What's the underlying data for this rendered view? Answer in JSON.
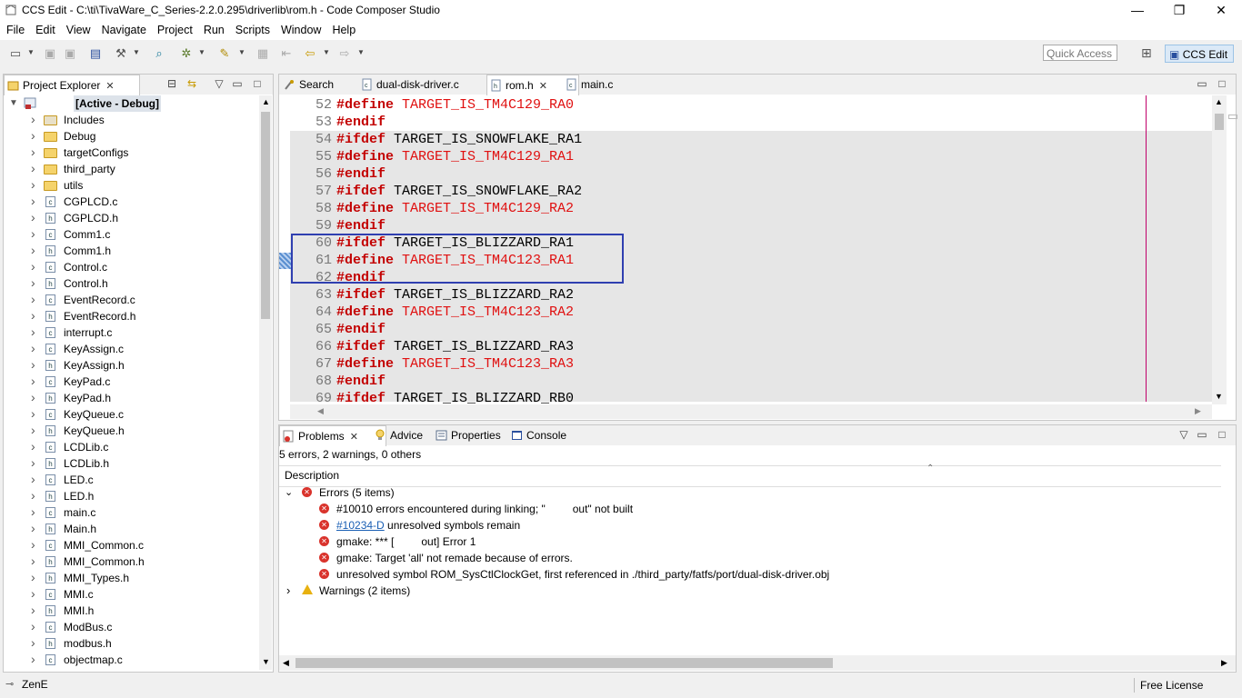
{
  "window": {
    "title": "CCS Edit - C:\\ti\\TivaWare_C_Series-2.2.0.295\\driverlib\\rom.h - Code Composer Studio",
    "minimize": "—",
    "restore": "❐",
    "close": "✕"
  },
  "menu": [
    "File",
    "Edit",
    "View",
    "Navigate",
    "Project",
    "Run",
    "Scripts",
    "Window",
    "Help"
  ],
  "toolbar": {
    "quick_access_placeholder": "Quick Access",
    "perspective_label": "CCS Edit"
  },
  "project_explorer": {
    "title": "Project Explorer",
    "root_label": "[Active - Debug]",
    "items": [
      {
        "label": "Includes",
        "kind": "includes"
      },
      {
        "label": "Debug",
        "kind": "folder"
      },
      {
        "label": "targetConfigs",
        "kind": "folder"
      },
      {
        "label": "third_party",
        "kind": "folder"
      },
      {
        "label": "utils",
        "kind": "folder"
      },
      {
        "label": "CGPLCD.c",
        "kind": "c"
      },
      {
        "label": "CGPLCD.h",
        "kind": "h"
      },
      {
        "label": "Comm1.c",
        "kind": "c"
      },
      {
        "label": "Comm1.h",
        "kind": "h"
      },
      {
        "label": "Control.c",
        "kind": "c"
      },
      {
        "label": "Control.h",
        "kind": "h"
      },
      {
        "label": "EventRecord.c",
        "kind": "c"
      },
      {
        "label": "EventRecord.h",
        "kind": "h"
      },
      {
        "label": "interrupt.c",
        "kind": "c"
      },
      {
        "label": "KeyAssign.c",
        "kind": "c"
      },
      {
        "label": "KeyAssign.h",
        "kind": "h"
      },
      {
        "label": "KeyPad.c",
        "kind": "c"
      },
      {
        "label": "KeyPad.h",
        "kind": "h"
      },
      {
        "label": "KeyQueue.c",
        "kind": "c"
      },
      {
        "label": "KeyQueue.h",
        "kind": "h"
      },
      {
        "label": "LCDLib.c",
        "kind": "c"
      },
      {
        "label": "LCDLib.h",
        "kind": "h"
      },
      {
        "label": "LED.c",
        "kind": "c"
      },
      {
        "label": "LED.h",
        "kind": "h"
      },
      {
        "label": "main.c",
        "kind": "c"
      },
      {
        "label": "Main.h",
        "kind": "h"
      },
      {
        "label": "MMI_Common.c",
        "kind": "c"
      },
      {
        "label": "MMI_Common.h",
        "kind": "h"
      },
      {
        "label": "MMI_Types.h",
        "kind": "h"
      },
      {
        "label": "MMI.c",
        "kind": "c"
      },
      {
        "label": "MMI.h",
        "kind": "h"
      },
      {
        "label": "ModBus.c",
        "kind": "c"
      },
      {
        "label": "modbus.h",
        "kind": "h"
      },
      {
        "label": "objectmap.c",
        "kind": "c"
      }
    ]
  },
  "editor": {
    "tabs": [
      {
        "label": "Search",
        "active": false
      },
      {
        "label": "dual-disk-driver.c",
        "active": false
      },
      {
        "label": "rom.h",
        "active": true
      },
      {
        "label": "main.c",
        "active": false
      }
    ],
    "lines": [
      {
        "num": "52",
        "directive": "#define",
        "name": "TARGET_IS_TM4C129_RA0"
      },
      {
        "num": "53",
        "directive": "#endif",
        "name": ""
      },
      {
        "num": "54",
        "directive": "#ifdef",
        "name": "TARGET_IS_SNOWFLAKE_RA1"
      },
      {
        "num": "55",
        "directive": "#define",
        "name": "TARGET_IS_TM4C129_RA1"
      },
      {
        "num": "56",
        "directive": "#endif",
        "name": ""
      },
      {
        "num": "57",
        "directive": "#ifdef",
        "name": "TARGET_IS_SNOWFLAKE_RA2"
      },
      {
        "num": "58",
        "directive": "#define",
        "name": "TARGET_IS_TM4C129_RA2"
      },
      {
        "num": "59",
        "directive": "#endif",
        "name": ""
      },
      {
        "num": "60",
        "directive": "#ifdef",
        "name": "TARGET_IS_BLIZZARD_RA1"
      },
      {
        "num": "61",
        "directive": "#define",
        "name": "TARGET_IS_TM4C123_RA1"
      },
      {
        "num": "62",
        "directive": "#endif",
        "name": ""
      },
      {
        "num": "63",
        "directive": "#ifdef",
        "name": "TARGET_IS_BLIZZARD_RA2"
      },
      {
        "num": "64",
        "directive": "#define",
        "name": "TARGET_IS_TM4C123_RA2"
      },
      {
        "num": "65",
        "directive": "#endif",
        "name": ""
      },
      {
        "num": "66",
        "directive": "#ifdef",
        "name": "TARGET_IS_BLIZZARD_RA3"
      },
      {
        "num": "67",
        "directive": "#define",
        "name": "TARGET_IS_TM4C123_RA3"
      },
      {
        "num": "68",
        "directive": "#endif",
        "name": ""
      },
      {
        "num": "69",
        "directive": "#ifdef",
        "name": "TARGET_IS_BLIZZARD_RB0"
      }
    ]
  },
  "problems": {
    "tabs": [
      "Problems",
      "Advice",
      "Properties",
      "Console"
    ],
    "summary": "5 errors, 2 warnings, 0 others",
    "column_header": "Description",
    "errors_group": "Errors (5 items)",
    "errors": [
      {
        "pre": "#10010 errors encountered during linking; \"",
        "post": "out\" not built",
        "link": ""
      },
      {
        "pre": "",
        "post": " unresolved symbols remain",
        "link": "#10234-D"
      },
      {
        "pre": "gmake: *** [",
        "post": "out] Error 1",
        "link": ""
      },
      {
        "pre": "gmake: Target 'all' not remade because of errors.",
        "post": "",
        "link": ""
      },
      {
        "pre": "unresolved symbol ROM_SysCtlClockGet, first referenced in ./third_party/fatfs/port/dual-disk-driver.obj",
        "post": "",
        "link": ""
      }
    ],
    "warnings_group": "Warnings (2 items)"
  },
  "statusbar": {
    "left": "ZenE",
    "right": "Free License"
  },
  "colors": {
    "highlight_box": "#2f3fb0",
    "directive": "#7f0055",
    "macro": "#e01010",
    "error": "#d9332c",
    "print_margin": "#c0006a",
    "gray_block_bg": "#e6e6e6"
  }
}
